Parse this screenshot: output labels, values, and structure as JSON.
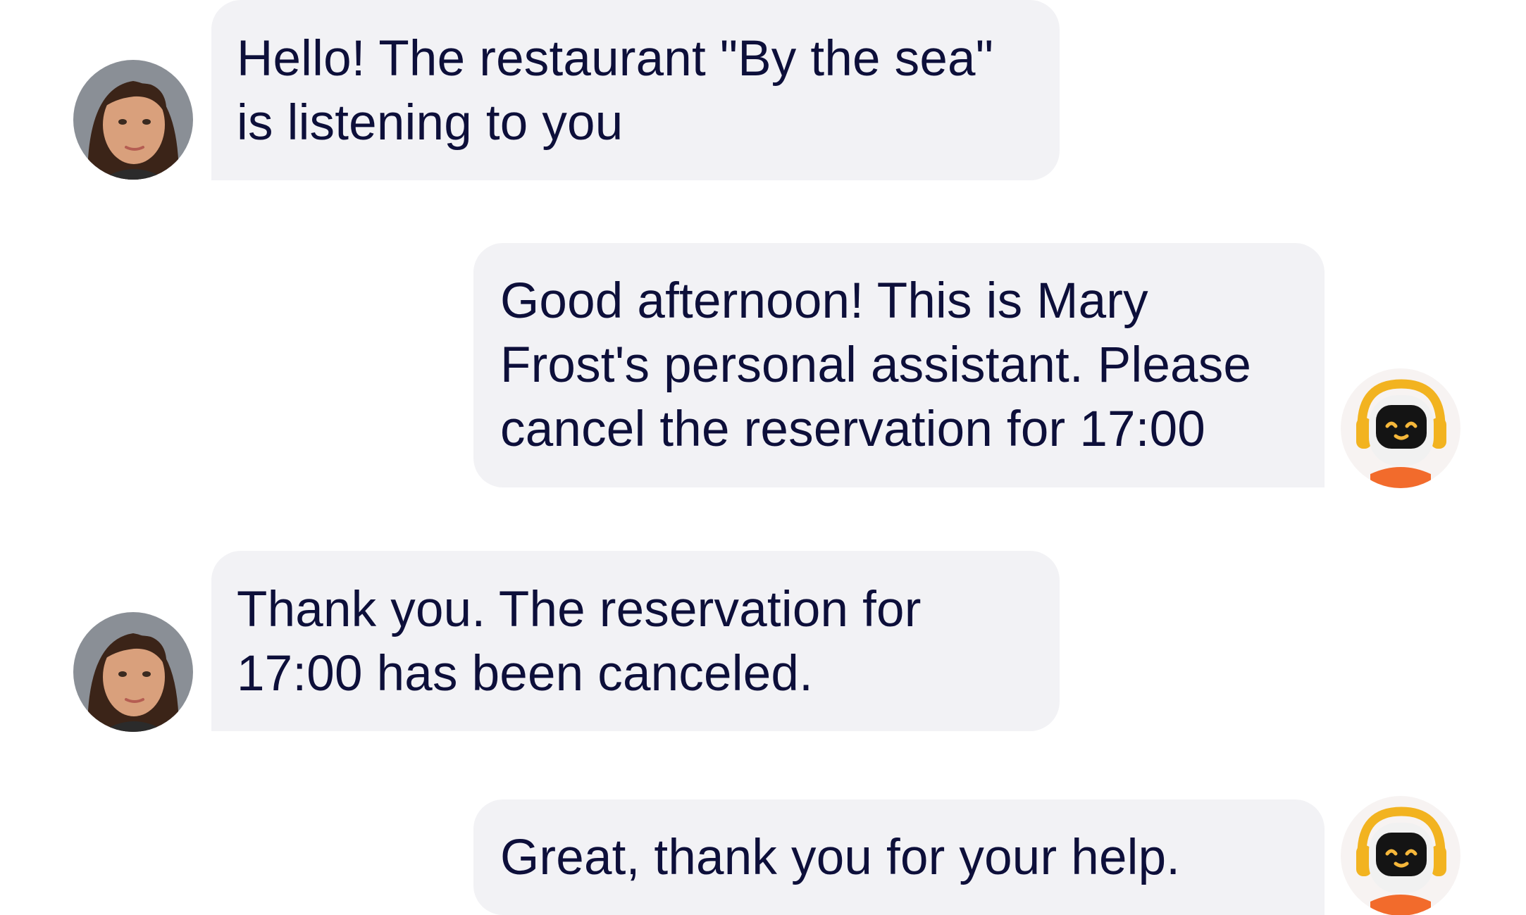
{
  "chat": {
    "messages": [
      {
        "sender": "restaurant",
        "avatar_icon": "woman-avatar-icon",
        "text": "Hello! The restaurant \"By the sea\"\nis listening to you"
      },
      {
        "sender": "assistant",
        "avatar_icon": "robot-avatar-icon",
        "text": "Good afternoon! This is Mary\nFrost's personal assistant. Please\ncancel the reservation for 17:00"
      },
      {
        "sender": "restaurant",
        "avatar_icon": "woman-avatar-icon",
        "text": "Thank you. The reservation for\n17:00 has been canceled."
      },
      {
        "sender": "assistant",
        "avatar_icon": "robot-avatar-icon",
        "text": "Great, thank you for your help."
      }
    ]
  },
  "colors": {
    "bubble_background": "#f2f2f5",
    "text": "#0d0f3a",
    "robot_headphones": "#f2b320",
    "robot_body": "#f26b2c",
    "robot_eyes": "#f5b73a"
  }
}
